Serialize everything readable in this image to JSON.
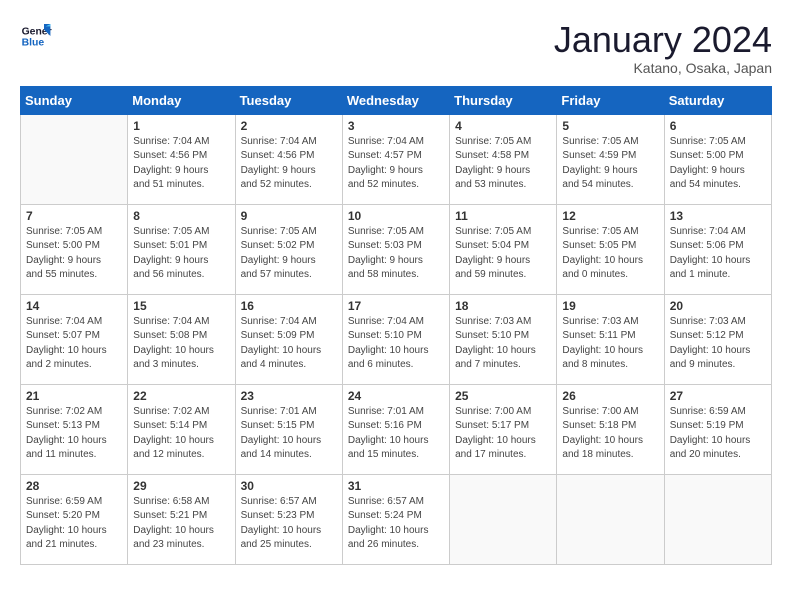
{
  "header": {
    "logo_line1": "General",
    "logo_line2": "Blue",
    "month": "January 2024",
    "location": "Katano, Osaka, Japan"
  },
  "weekdays": [
    "Sunday",
    "Monday",
    "Tuesday",
    "Wednesday",
    "Thursday",
    "Friday",
    "Saturday"
  ],
  "weeks": [
    [
      {
        "day": "",
        "info": ""
      },
      {
        "day": "1",
        "info": "Sunrise: 7:04 AM\nSunset: 4:56 PM\nDaylight: 9 hours\nand 51 minutes."
      },
      {
        "day": "2",
        "info": "Sunrise: 7:04 AM\nSunset: 4:56 PM\nDaylight: 9 hours\nand 52 minutes."
      },
      {
        "day": "3",
        "info": "Sunrise: 7:04 AM\nSunset: 4:57 PM\nDaylight: 9 hours\nand 52 minutes."
      },
      {
        "day": "4",
        "info": "Sunrise: 7:05 AM\nSunset: 4:58 PM\nDaylight: 9 hours\nand 53 minutes."
      },
      {
        "day": "5",
        "info": "Sunrise: 7:05 AM\nSunset: 4:59 PM\nDaylight: 9 hours\nand 54 minutes."
      },
      {
        "day": "6",
        "info": "Sunrise: 7:05 AM\nSunset: 5:00 PM\nDaylight: 9 hours\nand 54 minutes."
      }
    ],
    [
      {
        "day": "7",
        "info": "Sunrise: 7:05 AM\nSunset: 5:00 PM\nDaylight: 9 hours\nand 55 minutes."
      },
      {
        "day": "8",
        "info": "Sunrise: 7:05 AM\nSunset: 5:01 PM\nDaylight: 9 hours\nand 56 minutes."
      },
      {
        "day": "9",
        "info": "Sunrise: 7:05 AM\nSunset: 5:02 PM\nDaylight: 9 hours\nand 57 minutes."
      },
      {
        "day": "10",
        "info": "Sunrise: 7:05 AM\nSunset: 5:03 PM\nDaylight: 9 hours\nand 58 minutes."
      },
      {
        "day": "11",
        "info": "Sunrise: 7:05 AM\nSunset: 5:04 PM\nDaylight: 9 hours\nand 59 minutes."
      },
      {
        "day": "12",
        "info": "Sunrise: 7:05 AM\nSunset: 5:05 PM\nDaylight: 10 hours\nand 0 minutes."
      },
      {
        "day": "13",
        "info": "Sunrise: 7:04 AM\nSunset: 5:06 PM\nDaylight: 10 hours\nand 1 minute."
      }
    ],
    [
      {
        "day": "14",
        "info": "Sunrise: 7:04 AM\nSunset: 5:07 PM\nDaylight: 10 hours\nand 2 minutes."
      },
      {
        "day": "15",
        "info": "Sunrise: 7:04 AM\nSunset: 5:08 PM\nDaylight: 10 hours\nand 3 minutes."
      },
      {
        "day": "16",
        "info": "Sunrise: 7:04 AM\nSunset: 5:09 PM\nDaylight: 10 hours\nand 4 minutes."
      },
      {
        "day": "17",
        "info": "Sunrise: 7:04 AM\nSunset: 5:10 PM\nDaylight: 10 hours\nand 6 minutes."
      },
      {
        "day": "18",
        "info": "Sunrise: 7:03 AM\nSunset: 5:10 PM\nDaylight: 10 hours\nand 7 minutes."
      },
      {
        "day": "19",
        "info": "Sunrise: 7:03 AM\nSunset: 5:11 PM\nDaylight: 10 hours\nand 8 minutes."
      },
      {
        "day": "20",
        "info": "Sunrise: 7:03 AM\nSunset: 5:12 PM\nDaylight: 10 hours\nand 9 minutes."
      }
    ],
    [
      {
        "day": "21",
        "info": "Sunrise: 7:02 AM\nSunset: 5:13 PM\nDaylight: 10 hours\nand 11 minutes."
      },
      {
        "day": "22",
        "info": "Sunrise: 7:02 AM\nSunset: 5:14 PM\nDaylight: 10 hours\nand 12 minutes."
      },
      {
        "day": "23",
        "info": "Sunrise: 7:01 AM\nSunset: 5:15 PM\nDaylight: 10 hours\nand 14 minutes."
      },
      {
        "day": "24",
        "info": "Sunrise: 7:01 AM\nSunset: 5:16 PM\nDaylight: 10 hours\nand 15 minutes."
      },
      {
        "day": "25",
        "info": "Sunrise: 7:00 AM\nSunset: 5:17 PM\nDaylight: 10 hours\nand 17 minutes."
      },
      {
        "day": "26",
        "info": "Sunrise: 7:00 AM\nSunset: 5:18 PM\nDaylight: 10 hours\nand 18 minutes."
      },
      {
        "day": "27",
        "info": "Sunrise: 6:59 AM\nSunset: 5:19 PM\nDaylight: 10 hours\nand 20 minutes."
      }
    ],
    [
      {
        "day": "28",
        "info": "Sunrise: 6:59 AM\nSunset: 5:20 PM\nDaylight: 10 hours\nand 21 minutes."
      },
      {
        "day": "29",
        "info": "Sunrise: 6:58 AM\nSunset: 5:21 PM\nDaylight: 10 hours\nand 23 minutes."
      },
      {
        "day": "30",
        "info": "Sunrise: 6:57 AM\nSunset: 5:23 PM\nDaylight: 10 hours\nand 25 minutes."
      },
      {
        "day": "31",
        "info": "Sunrise: 6:57 AM\nSunset: 5:24 PM\nDaylight: 10 hours\nand 26 minutes."
      },
      {
        "day": "",
        "info": ""
      },
      {
        "day": "",
        "info": ""
      },
      {
        "day": "",
        "info": ""
      }
    ]
  ]
}
